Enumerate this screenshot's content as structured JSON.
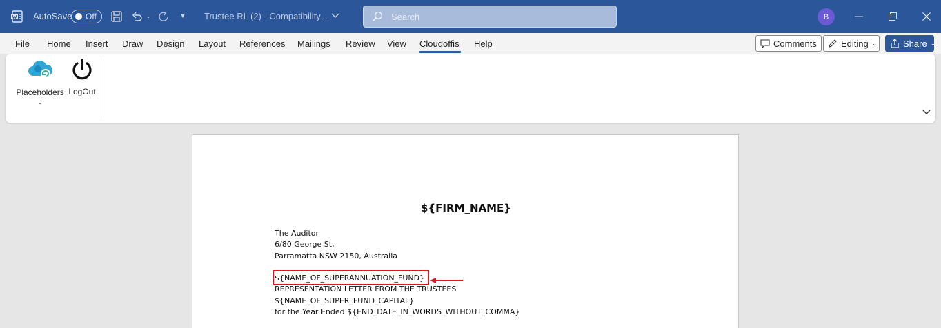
{
  "titlebar": {
    "autosave_label": "AutoSave",
    "autosave_state": "Off",
    "doc_title": "Trustee RL (2)  -  Compatibility...",
    "search_placeholder": "Search",
    "avatar_initial": "B",
    "accent_color": "#2b579a"
  },
  "menu": {
    "tabs": [
      "File",
      "Home",
      "Insert",
      "Draw",
      "Design",
      "Layout",
      "References",
      "Mailings",
      "Review",
      "View",
      "Cloudoffis",
      "Help"
    ],
    "active_tab": "Cloudoffis",
    "comments_label": "Comments",
    "editing_label": "Editing",
    "share_label": "Share"
  },
  "ribbon": {
    "placeholders_label": "Placeholders",
    "logout_label": "LogOut"
  },
  "document": {
    "firm_name": "${FIRM_NAME}",
    "lines": [
      "The Auditor",
      "6/80 George St,",
      "Parramatta NSW 2150, Australia",
      "${NAME_OF_SUPERANNUATION_FUND}",
      "REPRESENTATION LETTER FROM THE TRUSTEES",
      "${NAME_OF_SUPER_FUND_CAPITAL}",
      "for the Year Ended ${END_DATE_IN_WORDS_WITHOUT_COMMA}"
    ],
    "annotation_color": "#e0141e"
  }
}
